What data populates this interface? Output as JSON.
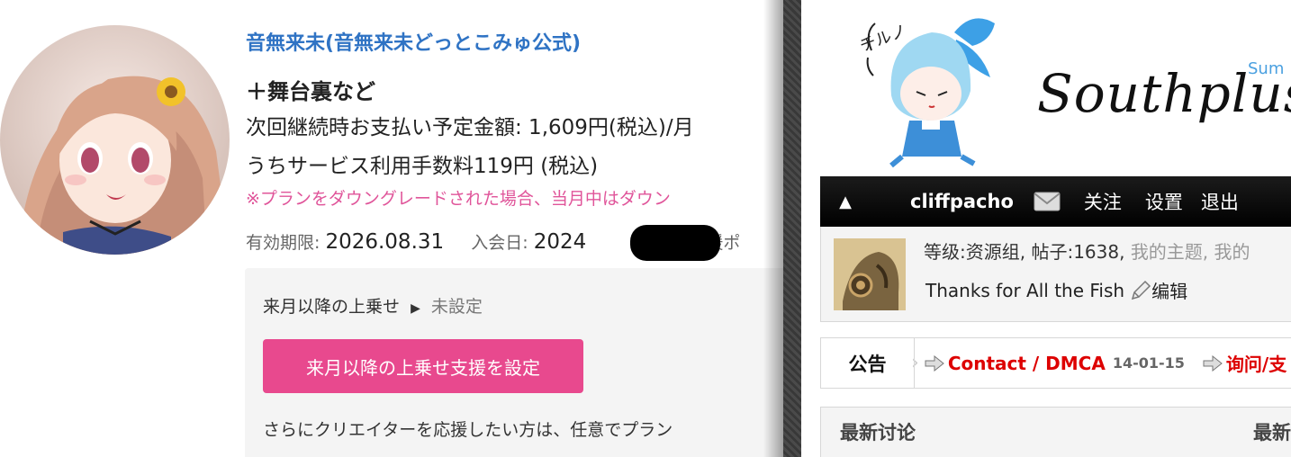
{
  "fanbox": {
    "plan_title": "音無来未(音無来未どっとこみゅ公式)",
    "plan_subtitle": "＋舞台裏など",
    "next_payment": "次回継続時お支払い予定金額: 1,609円(税込)/月",
    "service_fee": "うちサービス利用手数料119円 (税込)",
    "downgrade_note": "※プランをダウングレードされた場合、当月中はダウン",
    "expiry_label": "有効期限:",
    "expiry_value": "2026.08.31",
    "join_label": "入会日:",
    "join_value": "2024",
    "support_trailing": "支援ポ",
    "boost_label": "来月以降の上乗せ",
    "boost_status": "未設定",
    "boost_button": "来月以降の上乗せ支援を設定",
    "boost_desc": "さらにクリエイターを応援したい方は、任意でプラン",
    "accent_color": "#e8498e",
    "title_color": "#2f73c4"
  },
  "forum": {
    "logo_text": "Southplus",
    "logo_sub": "Sum",
    "nav": {
      "username": "cliffpacho",
      "follow": "关注",
      "settings": "设置",
      "logout": "退出"
    },
    "user": {
      "stats_prefix": "等级:资源组, 帖子:1638,",
      "my_topics": "我的主题,",
      "my_more": "我的",
      "signature": "Thanks for All the Fish",
      "edit": "编辑"
    },
    "notice": {
      "label": "公告",
      "items": [
        {
          "text": "Contact / DMCA",
          "date": "14-01-15"
        },
        {
          "text": "询问/支"
        }
      ]
    },
    "latest": {
      "title": "最新讨论",
      "right": "最新"
    }
  }
}
